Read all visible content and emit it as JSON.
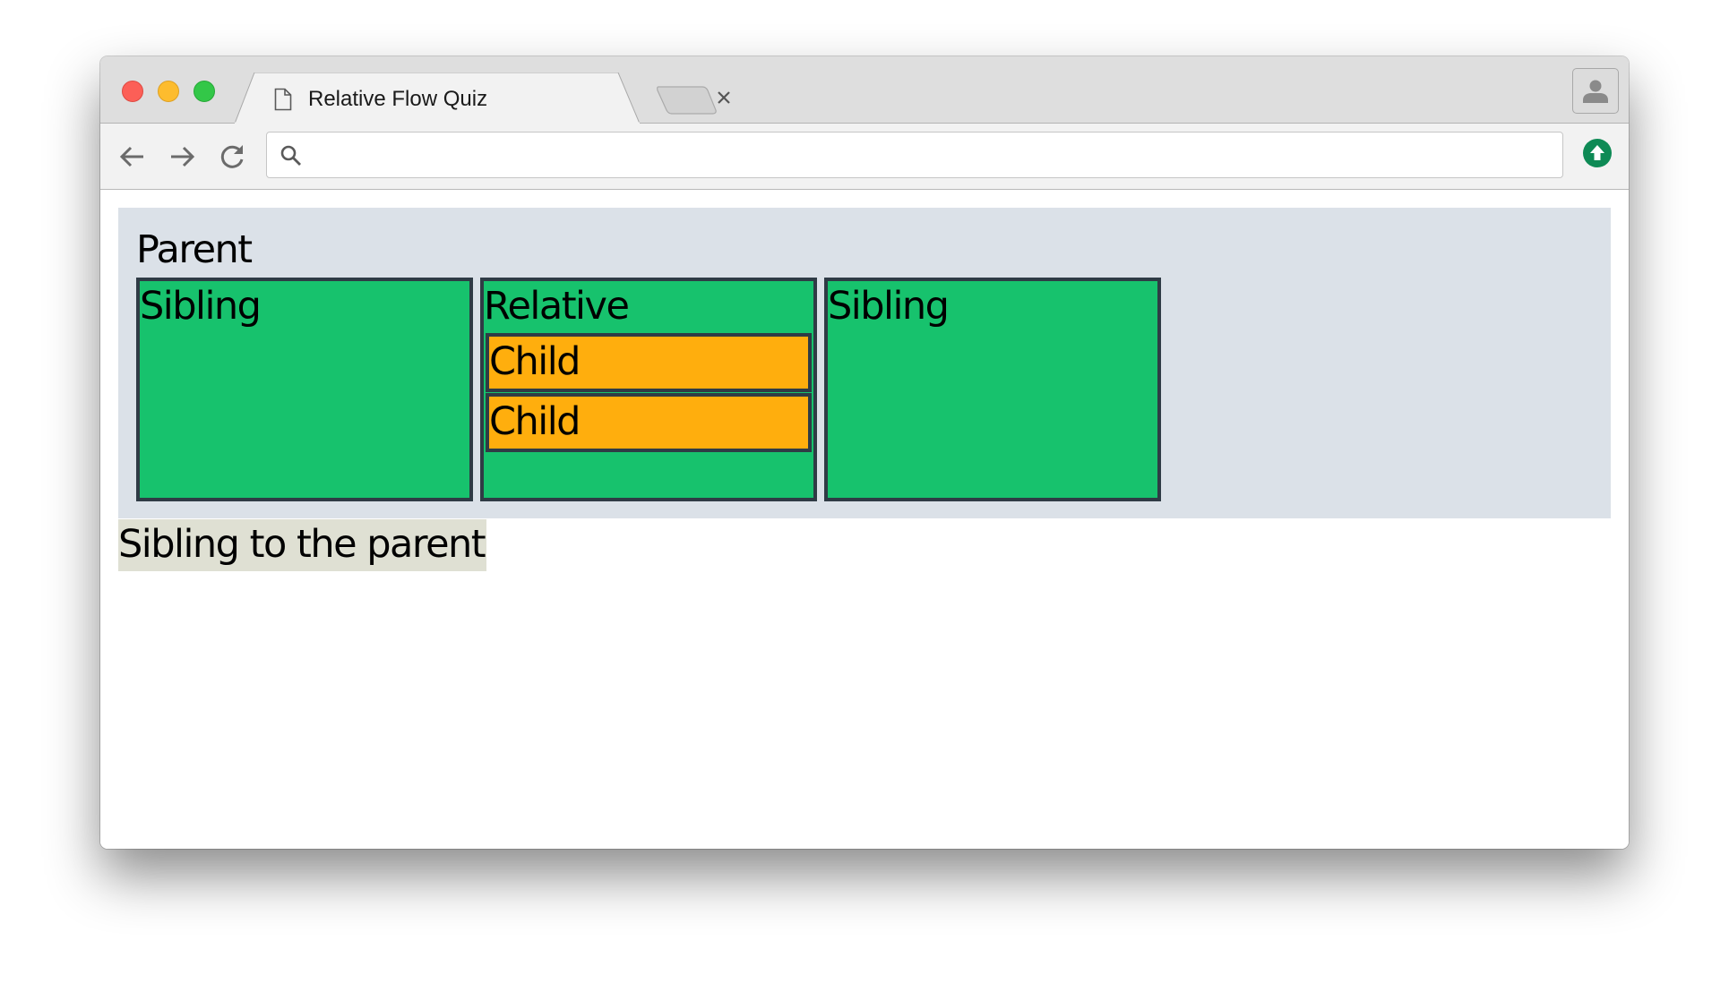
{
  "browser": {
    "tab": {
      "title": "Relative Flow Quiz",
      "icon": "document-icon",
      "close_icon": "close-icon"
    },
    "new_tab_icon": "new-tab-icon",
    "profile_icon": "person-icon",
    "toolbar": {
      "back_icon": "arrow-left-icon",
      "forward_icon": "arrow-right-icon",
      "reload_icon": "reload-icon",
      "omnibox": {
        "value": "",
        "icon": "search-icon"
      },
      "update_icon": "arrow-up-circle-icon"
    },
    "colors": {
      "update": "#0e8a55"
    }
  },
  "page": {
    "parent": {
      "label": "Parent",
      "background": "#dbe1e8",
      "boxes": [
        {
          "label": "Sibling",
          "color": "#17c26d"
        },
        {
          "label": "Relative",
          "color": "#17c26d",
          "children": [
            {
              "label": "Child",
              "color": "#ffae0d"
            },
            {
              "label": "Child",
              "color": "#ffae0d"
            }
          ]
        },
        {
          "label": "Sibling",
          "color": "#17c26d"
        }
      ]
    },
    "sibling_to_parent": {
      "label": "Sibling to the parent",
      "background": "#dfe0d3"
    }
  }
}
